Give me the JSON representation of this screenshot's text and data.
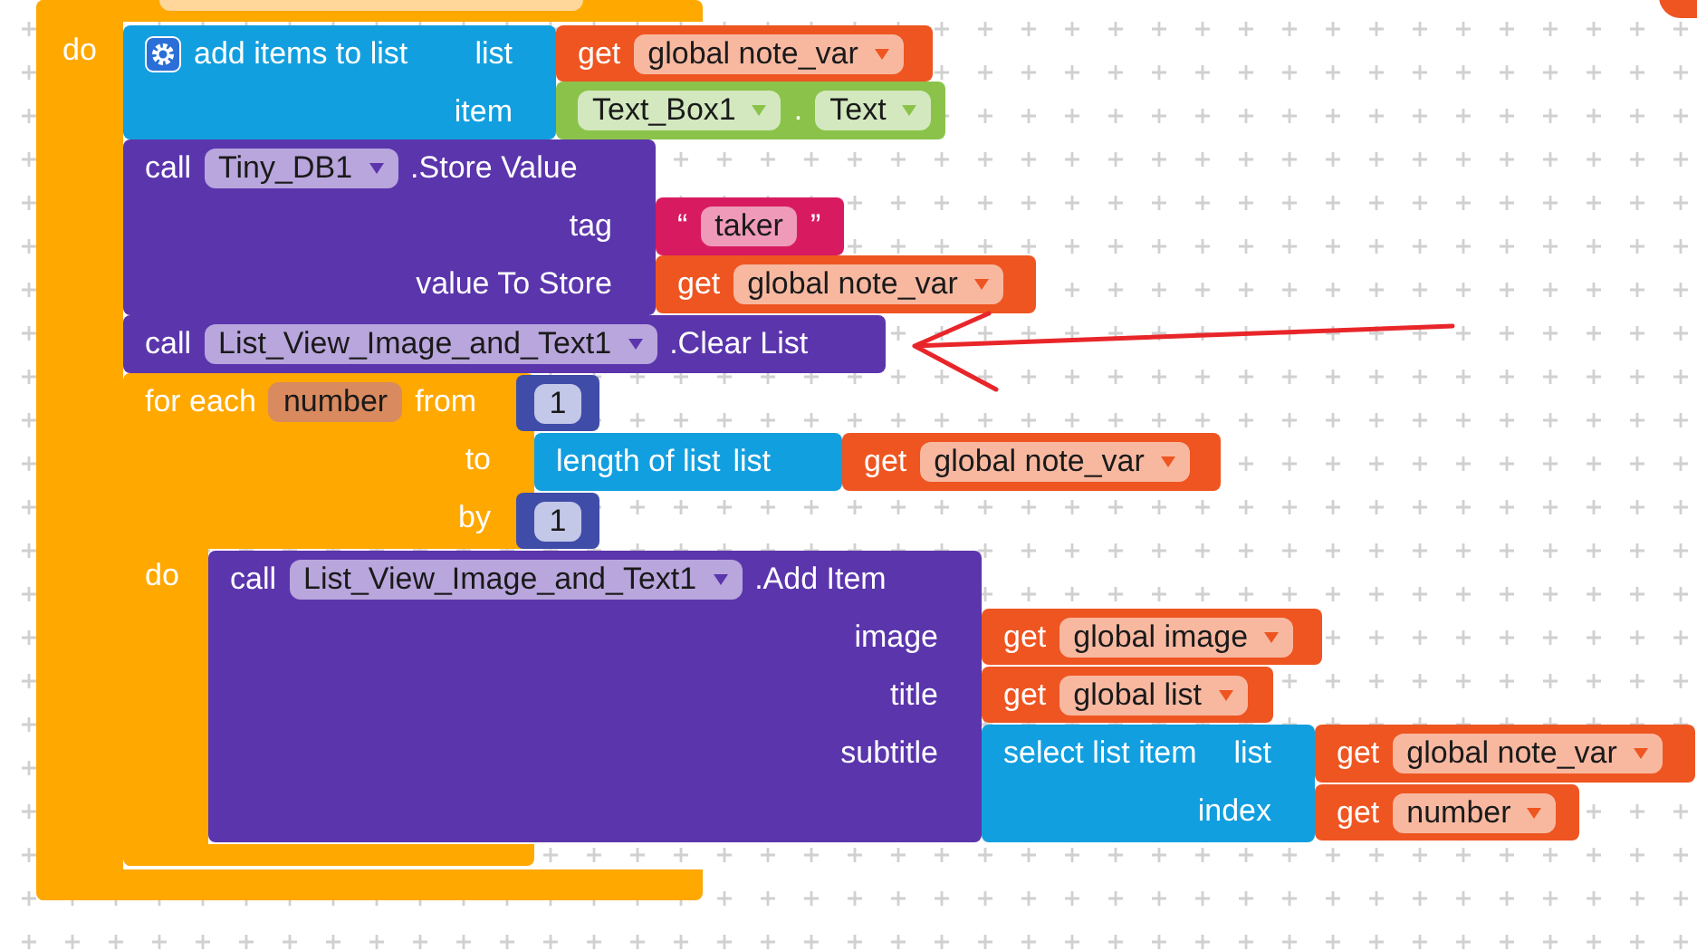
{
  "blocks": [
    {
      "kind": "event",
      "lines": [
        {
          "parts": [
            {
              "kind": "label",
              "text": "do"
            }
          ]
        }
      ]
    },
    {
      "kind": "list",
      "lines": [
        {
          "parts": [
            {
              "kind": "gear"
            },
            {
              "kind": "label",
              "text": "add items to list"
            },
            {
              "kind": "label",
              "text": "list"
            }
          ]
        },
        {
          "parts": [
            {
              "kind": "label",
              "text": "item"
            }
          ]
        }
      ]
    },
    {
      "kind": "variable",
      "lines": [
        {
          "parts": [
            {
              "kind": "label",
              "text": "get"
            },
            {
              "kind": "dropdown",
              "text": "global note_var"
            }
          ]
        }
      ]
    },
    {
      "kind": "component",
      "lines": [
        {
          "parts": [
            {
              "kind": "dropdown",
              "text": "Text_Box1"
            },
            {
              "kind": "label",
              "text": "."
            },
            {
              "kind": "dropdown",
              "text": "Text"
            }
          ]
        }
      ]
    },
    {
      "kind": "call",
      "lines": [
        {
          "parts": [
            {
              "kind": "label",
              "text": "call"
            },
            {
              "kind": "dropdown",
              "text": "Tiny_DB1"
            },
            {
              "kind": "label",
              "text": ".Store Value"
            }
          ]
        },
        {
          "parts": [
            {
              "kind": "label",
              "text": "tag"
            }
          ]
        },
        {
          "parts": [
            {
              "kind": "label",
              "text": "value To Store"
            }
          ]
        }
      ]
    },
    {
      "kind": "text",
      "lines": [
        {
          "parts": [
            {
              "kind": "label",
              "text": "“"
            },
            {
              "kind": "field",
              "text": "taker"
            },
            {
              "kind": "label",
              "text": "”"
            }
          ]
        }
      ]
    },
    {
      "kind": "variable",
      "lines": [
        {
          "parts": [
            {
              "kind": "label",
              "text": "get"
            },
            {
              "kind": "dropdown",
              "text": "global note_var"
            }
          ]
        }
      ]
    },
    {
      "kind": "call",
      "lines": [
        {
          "parts": [
            {
              "kind": "label",
              "text": "call"
            },
            {
              "kind": "dropdown",
              "text": "List_View_Image_and_Text1"
            },
            {
              "kind": "label",
              "text": ".Clear List"
            }
          ]
        }
      ]
    },
    {
      "kind": "control",
      "lines": [
        {
          "parts": [
            {
              "kind": "label",
              "text": "for each"
            },
            {
              "kind": "field",
              "text": "number"
            },
            {
              "kind": "label",
              "text": "from"
            }
          ]
        },
        {
          "parts": [
            {
              "kind": "label",
              "text": "to"
            }
          ]
        },
        {
          "parts": [
            {
              "kind": "label",
              "text": "by"
            }
          ]
        },
        {
          "parts": [
            {
              "kind": "label",
              "text": "do"
            }
          ]
        }
      ]
    },
    {
      "kind": "math",
      "lines": [
        {
          "parts": [
            {
              "kind": "field",
              "text": "1"
            }
          ]
        }
      ]
    },
    {
      "kind": "list",
      "lines": [
        {
          "parts": [
            {
              "kind": "label",
              "text": "length of list"
            },
            {
              "kind": "label",
              "text": "list"
            }
          ]
        }
      ]
    },
    {
      "kind": "variable",
      "lines": [
        {
          "parts": [
            {
              "kind": "label",
              "text": "get"
            },
            {
              "kind": "dropdown",
              "text": "global note_var"
            }
          ]
        }
      ]
    },
    {
      "kind": "math",
      "lines": [
        {
          "parts": [
            {
              "kind": "field",
              "text": "1"
            }
          ]
        }
      ]
    },
    {
      "kind": "call",
      "lines": [
        {
          "parts": [
            {
              "kind": "label",
              "text": "call"
            },
            {
              "kind": "dropdown",
              "text": "List_View_Image_and_Text1"
            },
            {
              "kind": "label",
              "text": ".Add Item"
            }
          ]
        },
        {
          "parts": [
            {
              "kind": "label",
              "text": "image"
            }
          ]
        },
        {
          "parts": [
            {
              "kind": "label",
              "text": "title"
            }
          ]
        },
        {
          "parts": [
            {
              "kind": "label",
              "text": "subtitle"
            }
          ]
        }
      ]
    },
    {
      "kind": "variable",
      "lines": [
        {
          "parts": [
            {
              "kind": "label",
              "text": "get"
            },
            {
              "kind": "dropdown",
              "text": "global image"
            }
          ]
        }
      ]
    },
    {
      "kind": "variable",
      "lines": [
        {
          "parts": [
            {
              "kind": "label",
              "text": "get"
            },
            {
              "kind": "dropdown",
              "text": "global list"
            }
          ]
        }
      ]
    },
    {
      "kind": "list",
      "lines": [
        {
          "parts": [
            {
              "kind": "label",
              "text": "select list item"
            },
            {
              "kind": "label",
              "text": "list"
            }
          ]
        },
        {
          "parts": [
            {
              "kind": "label",
              "text": "index"
            }
          ]
        }
      ]
    },
    {
      "kind": "variable",
      "lines": [
        {
          "parts": [
            {
              "kind": "label",
              "text": "get"
            },
            {
              "kind": "dropdown",
              "text": "global note_var"
            }
          ]
        }
      ]
    },
    {
      "kind": "variable",
      "lines": [
        {
          "parts": [
            {
              "kind": "label",
              "text": "get"
            },
            {
              "kind": "dropdown",
              "text": "number"
            }
          ]
        }
      ]
    }
  ]
}
